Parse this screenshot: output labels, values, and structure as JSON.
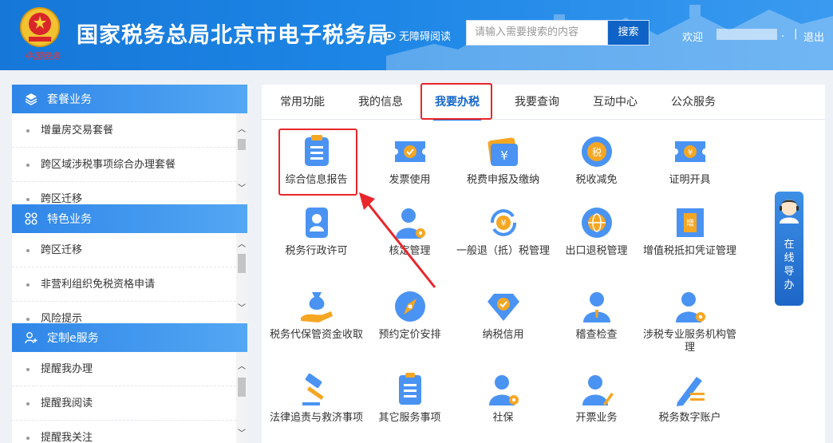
{
  "header": {
    "emblem_text": "中国税务",
    "site_title": "国家税务总局北京市电子税务局",
    "accessibility_label": "无障碍阅读",
    "search": {
      "placeholder": "请输入需要搜索的内容",
      "button_label": "搜索"
    },
    "welcome_label": "欢迎",
    "dot": ".",
    "separator": "|",
    "logout_label": "退出"
  },
  "sidebar": {
    "sections": [
      {
        "title": "套餐业务",
        "icon": "layers-icon",
        "items": [
          "增量房交易套餐",
          "跨区域涉税事项综合办理套餐",
          "跨区迁移"
        ]
      },
      {
        "title": "特色业务",
        "icon": "grid-icon",
        "items": [
          "跨区迁移",
          "非营利组织免税资格申请",
          "风险提示"
        ]
      },
      {
        "title": "定制e服务",
        "icon": "user-plus-icon",
        "items": [
          "提醒我办理",
          "提醒我阅读",
          "提醒我关注"
        ]
      }
    ]
  },
  "main": {
    "tabs": [
      "常用功能",
      "我的信息",
      "我要办税",
      "我要查询",
      "互动中心",
      "公众服务"
    ],
    "active_tab": "我要办税",
    "services": [
      {
        "label": "综合信息报告",
        "icon": "clipboard-icon"
      },
      {
        "label": "发票使用",
        "icon": "invoice-ticket-icon"
      },
      {
        "label": "税费申报及缴纳",
        "icon": "yuan-wallet-icon"
      },
      {
        "label": "税收减免",
        "icon": "tax-reduction-icon"
      },
      {
        "label": "证明开具",
        "icon": "certificate-ticket-icon"
      },
      {
        "label": "税务行政许可",
        "icon": "id-card-icon"
      },
      {
        "label": "核定管理",
        "icon": "user-gear-icon"
      },
      {
        "label": "一般退（抵）税管理",
        "icon": "yuan-refresh-icon"
      },
      {
        "label": "出口退税管理",
        "icon": "globe-icon"
      },
      {
        "label": "增值税抵扣凭证管理",
        "icon": "vat-ticket-icon"
      },
      {
        "label": "税务代保管资金收取",
        "icon": "money-bag-hand-icon"
      },
      {
        "label": "预约定价安排",
        "icon": "compass-icon"
      },
      {
        "label": "纳税信用",
        "icon": "diamond-check-icon"
      },
      {
        "label": "稽查检查",
        "icon": "person-icon"
      },
      {
        "label": "涉税专业服务机构管理",
        "icon": "user-gear-icon"
      },
      {
        "label": "法律追责与救济事项",
        "icon": "gavel-icon"
      },
      {
        "label": "其它服务事项",
        "icon": "list-doc-icon"
      },
      {
        "label": "社保",
        "icon": "user-gear-icon"
      },
      {
        "label": "开票业务",
        "icon": "user-pen-icon"
      },
      {
        "label": "税务数字账户",
        "icon": "pen-lines-icon"
      }
    ]
  },
  "guide": {
    "label": "在线导办",
    "chars": [
      "在",
      "线",
      "导",
      "办"
    ]
  },
  "colors": {
    "brand_blue": "#1677d8",
    "highlight_red": "#e8262b",
    "icon_blue": "#3b8cf0",
    "icon_orange": "#f5a623"
  }
}
